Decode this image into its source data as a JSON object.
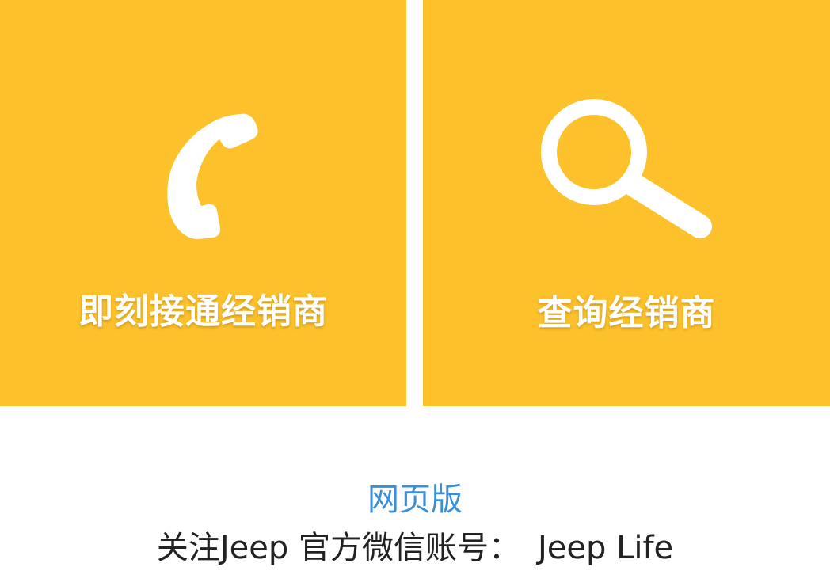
{
  "tiles": {
    "call": {
      "label": "即刻接通经销商",
      "icon": "phone-icon"
    },
    "search": {
      "label": "查询经销商",
      "icon": "search-icon"
    }
  },
  "footer": {
    "web_version_link": "网页版",
    "follow_prefix": "关注Jeep 官方微信账号：",
    "account_name": "Jeep Life"
  },
  "colors": {
    "tile_background": "#fcc12b",
    "tile_text": "#ffffff",
    "link": "#3b8fd8",
    "body_text": "#222222",
    "page_background": "#ffffff"
  }
}
